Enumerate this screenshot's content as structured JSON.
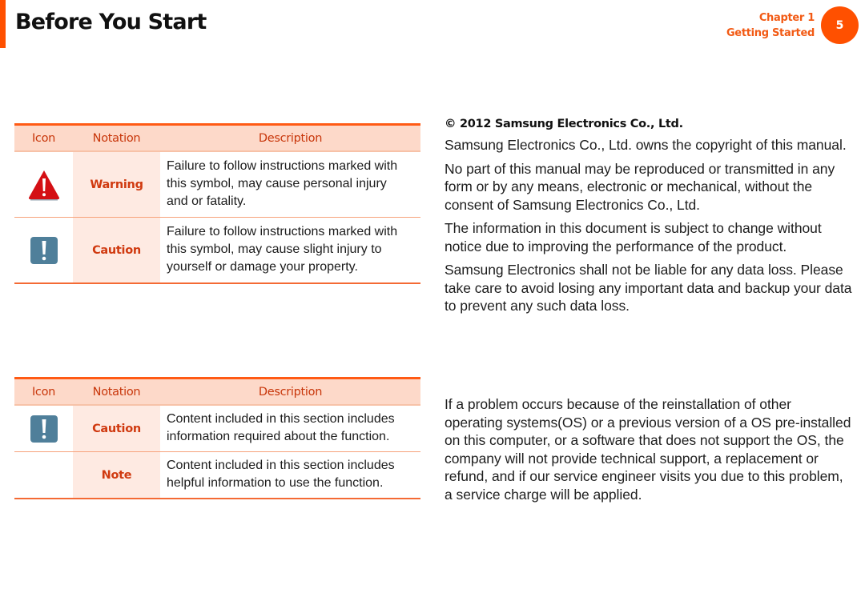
{
  "header": {
    "title": "Before You Start",
    "chapter_label": "Chapter 1",
    "chapter_name": "Getting Started",
    "page_number": "5",
    "accent_color": "#ff5000"
  },
  "safety_table": {
    "columns": [
      "Icon",
      "Notation",
      "Description"
    ],
    "rows": [
      {
        "icon": "warning-triangle-icon",
        "notation": "Warning",
        "description": "Failure to follow instructions marked with\nthis symbol, may cause personal injury\nand or fatality."
      },
      {
        "icon": "caution-exclamation-icon",
        "notation": "Caution",
        "description": "Failure to follow instructions marked with\nthis symbol, may cause slight injury to\nyourself or damage your property."
      }
    ]
  },
  "text_notation_table": {
    "columns": [
      "Icon",
      "Notation",
      "Description"
    ],
    "rows": [
      {
        "icon": "caution-exclamation-icon",
        "notation": "Caution",
        "description": "Content included in this section includes\ninformation required about the function."
      },
      {
        "icon": "",
        "notation": "Note",
        "description": "Content included in this section includes\nhelpful information to use the function."
      }
    ]
  },
  "copyright": {
    "title": "© 2012 Samsung Electronics Co., Ltd.",
    "paragraphs": [
      "Samsung Electronics Co., Ltd. owns the copyright of this manual.",
      "No part of this manual may be reproduced or transmitted in any\nform or by any means, electronic or mechanical, without the\nconsent of Samsung Electronics Co., Ltd.",
      "The information in this document is subject to change without\nnotice due to improving the performance of the product.",
      "Samsung Electronics shall not be liable for any data loss. Please\ntake care to avoid losing any important data and backup your data\nto prevent any such data loss."
    ]
  },
  "os_disclaimer": {
    "paragraph": "If a problem occurs because of the reinstallation of other\noperating systems(OS) or a previous version of a OS pre-installed\non this computer, or a software that does not support the OS, the\ncompany will not provide technical support, a replacement or\nrefund, and if our service engineer visits you due to this problem,\na service charge will be applied."
  },
  "colors": {
    "header_fill": "#fdd9c9",
    "notation_fill": "#feeae2",
    "notation_text": "#d03a10",
    "warning_icon": "#d40f14",
    "caution_icon": "#4f7f9a"
  }
}
